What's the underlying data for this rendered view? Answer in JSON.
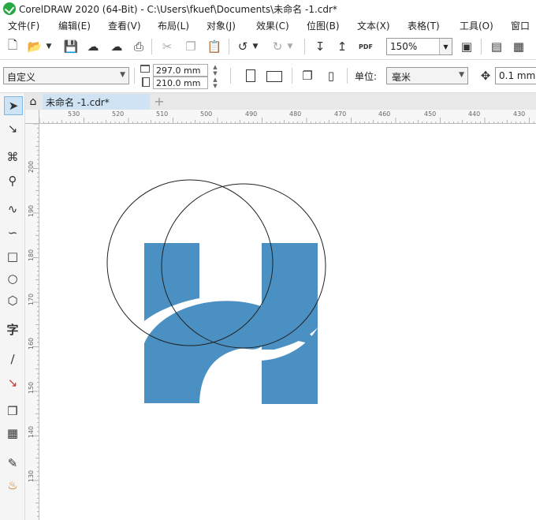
{
  "window": {
    "title": "CorelDRAW 2020 (64-Bit) - C:\\Users\\fkuef\\Documents\\未命名 -1.cdr*"
  },
  "menu": [
    "文件(F)",
    "编辑(E)",
    "查看(V)",
    "布局(L)",
    "对象(J)",
    "效果(C)",
    "位图(B)",
    "文本(X)",
    "表格(T)",
    "工具(O)",
    "窗口"
  ],
  "toolbar": {
    "zoom": "150%"
  },
  "propbar": {
    "preset": "自定义",
    "width": "297.0 mm",
    "height": "210.0 mm",
    "unit_label": "单位:",
    "unit": "毫米",
    "nudge": "0.1 mm"
  },
  "tabs": {
    "document": "未命名 -1.cdr*"
  },
  "ruler": {
    "h_labels": [
      "530",
      "520",
      "510",
      "500",
      "490",
      "480",
      "470",
      "460",
      "450",
      "440",
      "430"
    ],
    "v_labels": [
      "200",
      "190",
      "180",
      "170",
      "160",
      "150",
      "140",
      "130"
    ]
  },
  "colors": {
    "shape_fill": "#4a90c2",
    "outline": "#222222"
  }
}
